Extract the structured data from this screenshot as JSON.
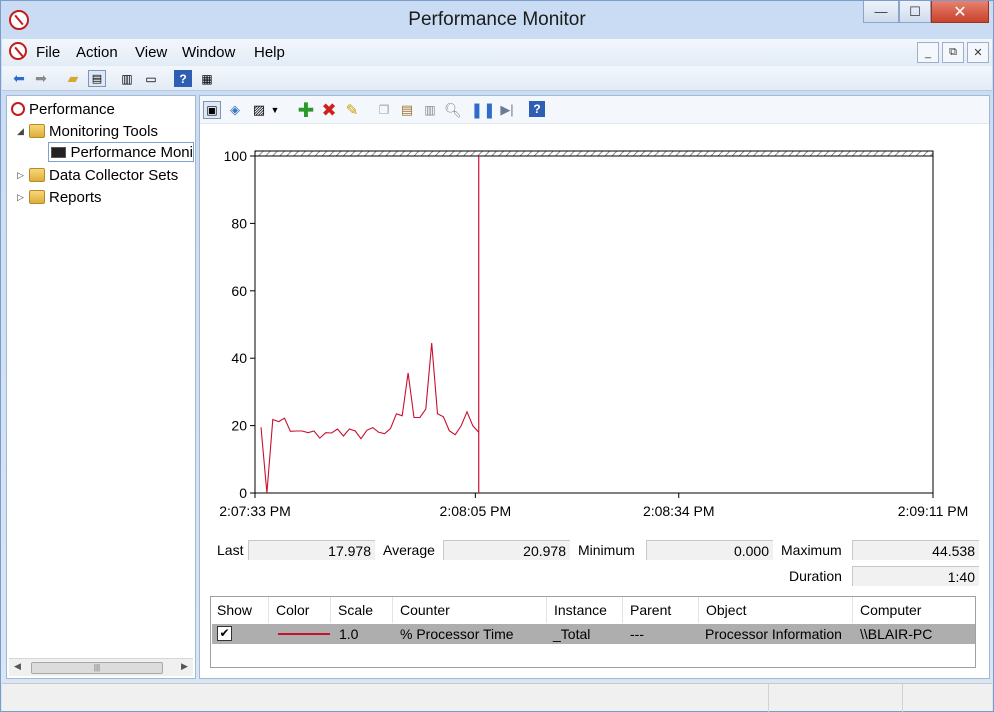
{
  "window": {
    "title": "Performance Monitor",
    "minimize": "—",
    "maximize": "☐",
    "close": "✕"
  },
  "menu": {
    "file": "File",
    "action": "Action",
    "view": "View",
    "window": "Window",
    "help": "Help"
  },
  "tree": {
    "root": "Performance",
    "monitoring_tools": "Monitoring Tools",
    "performance_monitor": "Performance Moni",
    "data_collector_sets": "Data Collector Sets",
    "reports": "Reports",
    "scroll_grip": "|||"
  },
  "chart_data": {
    "type": "line",
    "y_ticks": [
      "0",
      "20",
      "40",
      "60",
      "80",
      "100"
    ],
    "ylim": [
      0,
      100
    ],
    "x_tick_labels": [
      "2:07:33 PM",
      "2:08:05 PM",
      "2:08:34 PM",
      "2:09:11 PM"
    ],
    "duration_seconds": 100,
    "current_position_seconds": 33,
    "series": [
      {
        "color": "#c8102e",
        "values": [
          19.5,
          0,
          21.8,
          21.2,
          22.2,
          18.3,
          18.4,
          18.4,
          17.9,
          18.4,
          16.3,
          17.9,
          17.8,
          19.0,
          16.9,
          19.0,
          18.4,
          16.1,
          18.6,
          19.4,
          18.0,
          17.6,
          19.1,
          23.5,
          22.9,
          35.6,
          22.4,
          22.4,
          24.9,
          44.5,
          23.5,
          22.6,
          18.5,
          17.3,
          19.9,
          24.1,
          19.9,
          18.0
        ]
      }
    ]
  },
  "stats": {
    "last_label": "Last",
    "last_value": "17.978",
    "average_label": "Average",
    "average_value": "20.978",
    "minimum_label": "Minimum",
    "minimum_value": "0.000",
    "maximum_label": "Maximum",
    "maximum_value": "44.538",
    "duration_label": "Duration",
    "duration_value": "1:40"
  },
  "counter_table": {
    "headers": [
      "Show",
      "Color",
      "Scale",
      "Counter",
      "Instance",
      "Parent",
      "Object",
      "Computer"
    ],
    "row": {
      "show": "✔",
      "color": "#c8102e",
      "scale": "1.0",
      "counter": "% Processor Time",
      "instance": "_Total",
      "parent": "---",
      "object": "Processor Information",
      "computer": "\\\\BLAIR-PC"
    }
  }
}
